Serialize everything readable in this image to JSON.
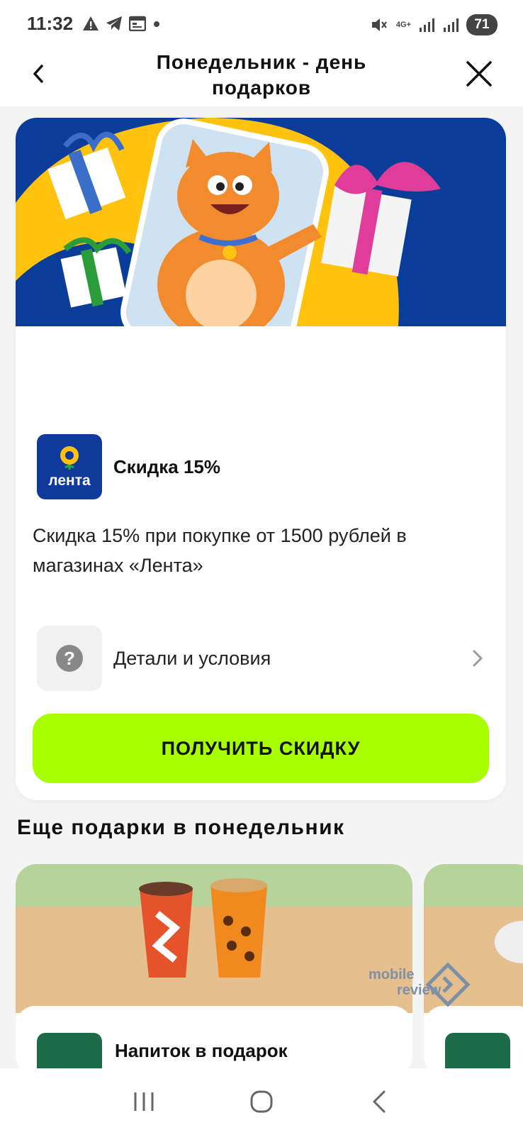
{
  "status_bar": {
    "time": "11:32",
    "network": "4G+",
    "battery": "71"
  },
  "header": {
    "title_line1": "Понедельник - день",
    "title_line2": "подарков"
  },
  "offer": {
    "brand_logo_text": "лента",
    "title": "Скидка 15%",
    "description": "Скидка 15% при покупке от 1500 рублей в магазинах «Лента»",
    "details_label": "Детали и условия",
    "cta_label": "ПОЛУЧИТЬ СКИДКУ"
  },
  "more_section": {
    "title": "Еще подарки в понедельник",
    "cards": [
      {
        "title": "Напиток в подарок"
      },
      {
        "title": ""
      }
    ]
  },
  "watermark": {
    "line1": "mobile",
    "line2": "review"
  },
  "colors": {
    "accent_green": "#a8ff00",
    "banner_blue": "#0a3d9a",
    "banner_yellow": "#ffc20e",
    "lenta_blue": "#0f3a9c",
    "vkusno_green": "#1e6b49"
  },
  "icons": [
    "warning-icon",
    "telegram-icon",
    "calendar-icon",
    "dot-icon",
    "mute-icon",
    "signal-icon",
    "back-icon",
    "close-icon",
    "question-icon",
    "chevron-right-icon",
    "recents-icon",
    "home-icon",
    "nav-back-icon"
  ]
}
